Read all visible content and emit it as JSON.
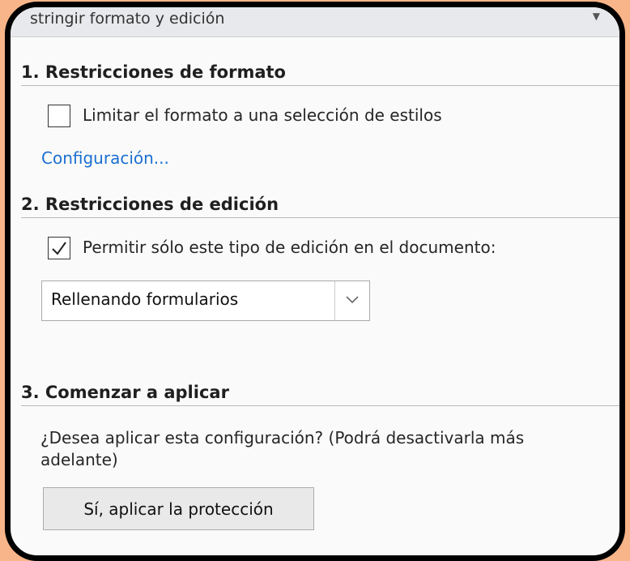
{
  "panel": {
    "title": "stringir formato y edición"
  },
  "section1": {
    "header": "1. Restricciones de formato",
    "checkbox_label": "Limitar el formato a una selección de estilos",
    "checked": false,
    "link": "Configuración..."
  },
  "section2": {
    "header": "2. Restricciones de edición",
    "checkbox_label": "Permitir sólo este tipo de edición en el documento:",
    "checked": true,
    "dropdown_value": "Rellenando formularios"
  },
  "section3": {
    "header": "3. Comenzar a aplicar",
    "description_line1": "¿Desea aplicar esta configuración? (Podrá desactivarla más",
    "description_line2": "adelante)",
    "button_label": "Sí, aplicar la protección"
  },
  "colors": {
    "background": "#f8b58a",
    "frame_border": "#000000",
    "link": "#1a6fd0"
  },
  "icons": [
    "checkbox-unchecked",
    "checkmark-icon",
    "chevron-down-icon",
    "pane-chevron-icon"
  ]
}
